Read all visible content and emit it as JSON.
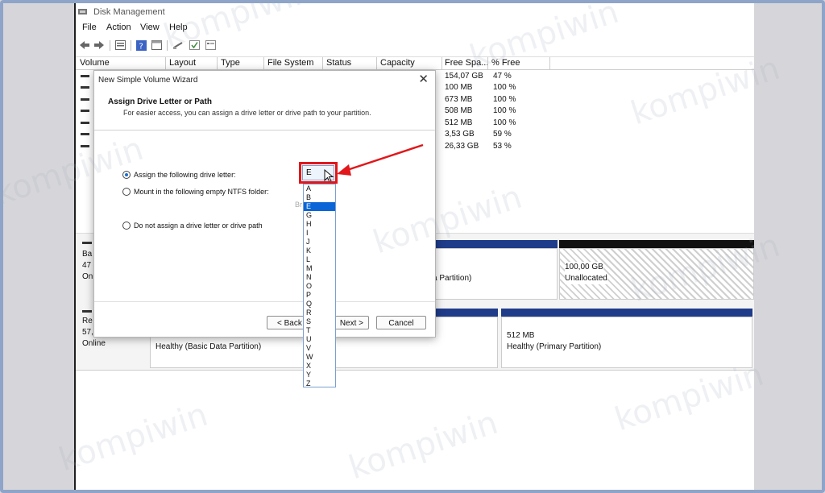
{
  "window": {
    "title": "Disk Management"
  },
  "menu": [
    "File",
    "Action",
    "View",
    "Help"
  ],
  "columns": [
    "Volume",
    "Layout",
    "Type",
    "File System",
    "Status",
    "Capacity",
    "Free Spa...",
    "% Free"
  ],
  "volumes": [
    {
      "free": "154,07 GB",
      "pct": "47 %"
    },
    {
      "free": "100 MB",
      "pct": "100 %"
    },
    {
      "free": "673 MB",
      "pct": "100 %"
    },
    {
      "free": "508 MB",
      "pct": "100 %"
    },
    {
      "free": "512 MB",
      "pct": "100 %"
    },
    {
      "free": "3,53 GB",
      "pct": "59 %"
    },
    {
      "free": "26,33 GB",
      "pct": "53 %"
    }
  ],
  "disks": {
    "disk0_label": [
      "Ba",
      "47",
      "On"
    ],
    "disk0_seg_partition": "a Partition)",
    "disk0_unalloc_size": "100,00 GB",
    "disk0_unalloc_label": "Unallocated",
    "disk1_label": [
      "Re",
      "57,",
      "Online"
    ],
    "disk1_seg1": "Healthy (Basic Data Partition)",
    "disk1_seg2_size": "512 MB",
    "disk1_seg2_label": "Healthy (Primary Partition)"
  },
  "wizard": {
    "title": "New Simple Volume Wizard",
    "heading": "Assign Drive Letter or Path",
    "subheading": "For easier access, you can assign a drive letter or drive path to your partition.",
    "option1": "Assign the following drive letter:",
    "option2": "Mount in the following empty NTFS folder:",
    "option3": "Do not assign a drive letter or drive path",
    "browse": "Br",
    "selected_letter": "E",
    "back": "< Back",
    "next": "Next >",
    "cancel": "Cancel"
  },
  "dropdown": {
    "options": [
      "A",
      "B",
      "E",
      "G",
      "H",
      "I",
      "J",
      "K",
      "L",
      "M",
      "N",
      "O",
      "P",
      "Q",
      "R",
      "S",
      "T",
      "U",
      "V",
      "W",
      "X",
      "Y",
      "Z"
    ],
    "selected_index": 2
  },
  "watermark": "kompiwin"
}
